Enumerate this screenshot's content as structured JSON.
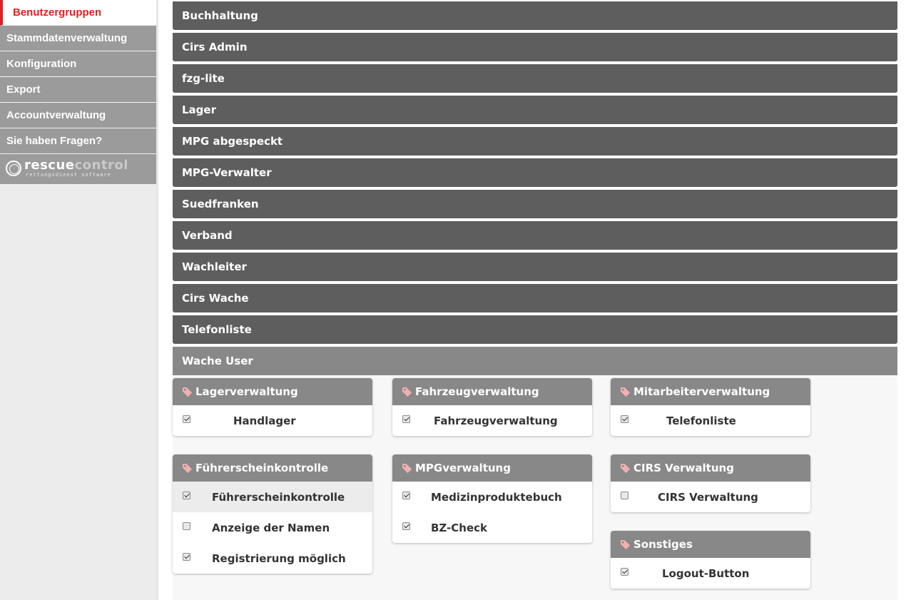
{
  "sidebar": {
    "items": [
      {
        "label": "Benutzergruppen",
        "active": true
      },
      {
        "label": "Stammdatenverwaltung"
      },
      {
        "label": "Konfiguration"
      },
      {
        "label": "Export"
      },
      {
        "label": "Accountverwaltung"
      },
      {
        "label": "Sie haben Fragen?"
      }
    ],
    "logo": {
      "word1": "rescue",
      "word2": "control",
      "subtitle": "rettungsdienst software"
    }
  },
  "groups": [
    "Buchhaltung",
    "Cirs Admin",
    "fzg-lite",
    "Lager",
    "MPG abgespeckt",
    "MPG-Verwalter",
    "Suedfranken",
    "Verband",
    "Wachleiter",
    "Cirs Wache",
    "Telefonliste",
    "Wache User"
  ],
  "open_group": "Wache User",
  "permission_cards": [
    {
      "title": "Lagerverwaltung",
      "rows": [
        {
          "label": "Handlager",
          "checked": true
        }
      ]
    },
    {
      "title": "Fahrzeugverwaltung",
      "rows": [
        {
          "label": "Fahrzeugverwaltung",
          "checked": true
        }
      ]
    },
    {
      "title": "Mitarbeiterverwaltung",
      "rows": [
        {
          "label": "Telefonliste",
          "checked": true
        }
      ]
    },
    {
      "title": "Führerscheinkontrolle",
      "rows": [
        {
          "label": "Führerscheinkontrolle",
          "checked": true
        },
        {
          "label": "Anzeige der Namen",
          "checked": false
        },
        {
          "label": "Registrierung möglich",
          "checked": true
        }
      ]
    },
    {
      "title": "MPGverwaltung",
      "rows": [
        {
          "label": "Medizinproduktebuch",
          "checked": true
        },
        {
          "label": "BZ-Check",
          "checked": true
        }
      ]
    },
    {
      "title": "CIRS Verwaltung",
      "rows": [
        {
          "label": "CIRS Verwaltung",
          "checked": false
        }
      ]
    },
    {
      "title": "Sonstiges",
      "rows": [
        {
          "label": "Logout-Button",
          "checked": true
        }
      ]
    }
  ],
  "colors": {
    "accent": "#e02020",
    "bar": "#5e5e5e",
    "bar_open": "#888888",
    "sidebar_item": "#9b9b9b"
  }
}
